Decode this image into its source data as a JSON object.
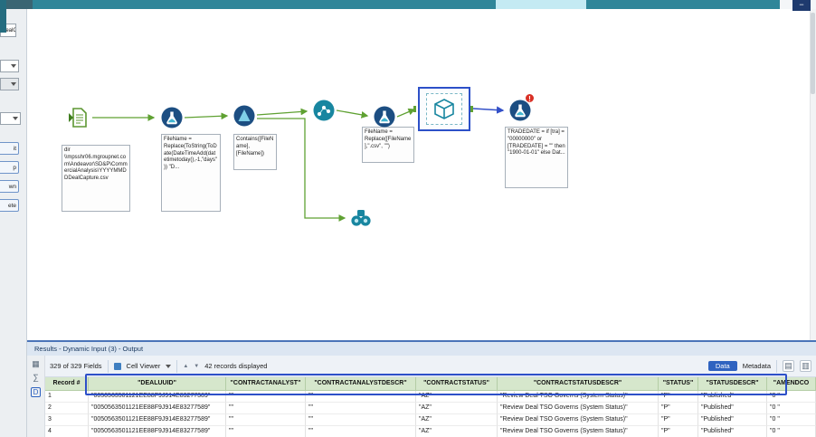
{
  "window": {
    "minimize_label": "−"
  },
  "icons": {
    "check": "✓",
    "up_arrow": "▲",
    "down_arrow": "▼",
    "grid": "▦",
    "sigma": "∑",
    "d_badge": "D",
    "copy": "▤",
    "save": "▥",
    "error": "!"
  },
  "left_panel": {
    "filename_fragment": "DealCa",
    "buttons": {
      "edit": "it",
      "up": "p",
      "down": "wn",
      "delete": "ete"
    }
  },
  "workflow": {
    "tools": [
      {
        "id": "input-data",
        "annotation": "dir \\\\mpsshr06.mgroupnet.com\\Andeavor\\SD&P\\CommercialAnalysis\\YYYYMMDDDealCapture.csv"
      },
      {
        "id": "formula-1",
        "annotation": "FileName = Replace(ToString(ToDate(DateTimeAdd(datetimetoday(),-1,\"days\")) \"D..."
      },
      {
        "id": "filter",
        "annotation": "Contains([FileName],[FileName])"
      },
      {
        "id": "join-dots"
      },
      {
        "id": "formula-2",
        "annotation": "FileName = Replace([FileName],\".csv\", \"\")"
      },
      {
        "id": "dynamic-input"
      },
      {
        "id": "formula-3",
        "annotation": "TRADEDATE = if [tra] = \"00000000\" or [TRADEDATE] = \"\" then \"1900-01-01\" else Dat..."
      },
      {
        "id": "browse"
      }
    ]
  },
  "results": {
    "title": "Results - Dynamic Input (3) - Output",
    "toolbar": {
      "fields_info": "329 of 329 Fields",
      "cell_viewer_label": "Cell Viewer",
      "records_info": "42 records displayed",
      "data_tab": "Data",
      "metadata_tab": "Metadata"
    },
    "table": {
      "columns": [
        "Record #",
        "\"DEALUUID\"",
        "\"CONTRACTANALYST\"",
        "\"CONTRACTANALYSTDESCR\"",
        "\"CONTRACTSTATUS\"",
        "\"CONTRACTSTATUSDESCR\"",
        "\"STATUS\"",
        "\"STATUSDESCR\"",
        "\"AMENDCO"
      ],
      "rows": [
        [
          "1",
          "\"0050563501121EE88F9J914E83277389\"",
          "\"\"",
          "\"\"",
          "\"AZ\"",
          "\"Review Deal TSO Governs (System Status)\"",
          "\"P\"",
          "\"Published\"",
          "\"0 \""
        ],
        [
          "2",
          "\"0050563501121EE88F9J914E83277589\"",
          "\"\"",
          "\"\"",
          "\"AZ\"",
          "\"Review Deal TSO Governs (System Status)\"",
          "\"P\"",
          "\"Published\"",
          "\"0 \""
        ],
        [
          "3",
          "\"0050563501121EE88F9J914E83277589\"",
          "\"\"",
          "\"\"",
          "\"AZ\"",
          "\"Review Deal TSO Governs (System Status)\"",
          "\"P\"",
          "\"Published\"",
          "\"0 \""
        ],
        [
          "4",
          "\"0050563501121EE88F9J914E83277589\"",
          "\"\"",
          "\"\"",
          "\"AZ\"",
          "\"Review Deal TSO Governs (System Status)\"",
          "\"P\"",
          "\"Published\"",
          "\"0 \""
        ]
      ]
    }
  }
}
